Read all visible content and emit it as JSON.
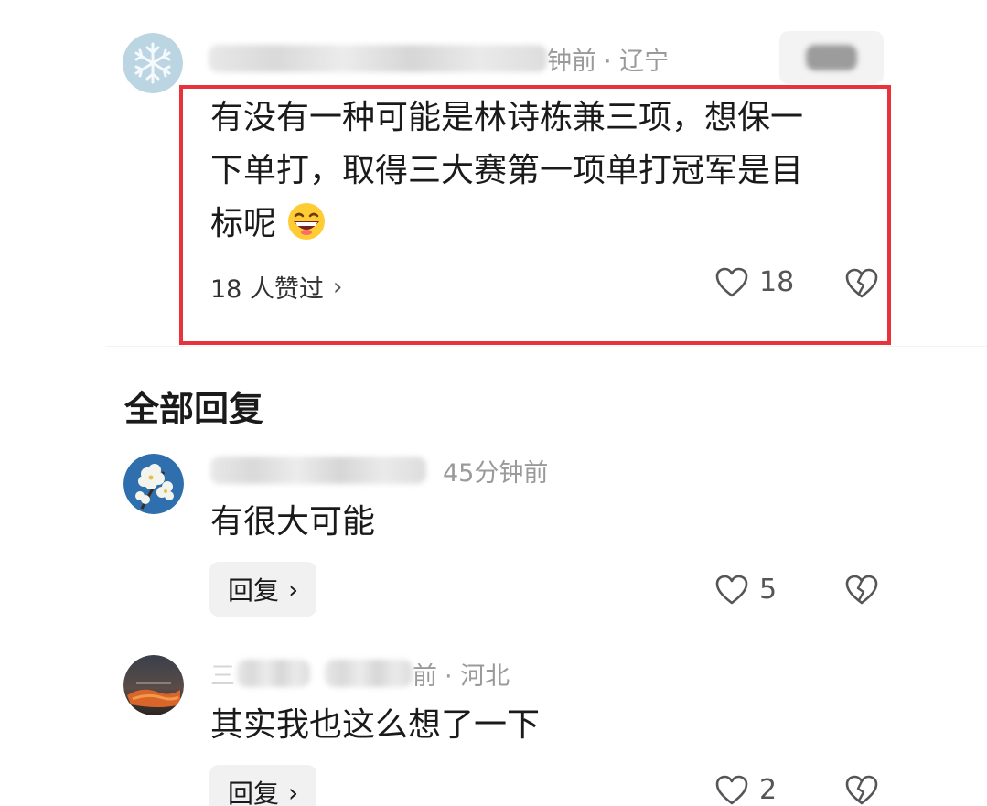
{
  "main_comment": {
    "meta_time": "钟前",
    "meta_location": "· 辽宁",
    "text_lines": [
      "有没有一种可能是林诗栋兼三项，想保一",
      "下单打，取得三大赛第一项单打冠军是目",
      "标呢"
    ],
    "emoji": "grinning-face-emoji",
    "likers": "18 人赞过",
    "likers_chevron": "›",
    "like_count": "18"
  },
  "section": {
    "title": "全部回复"
  },
  "replies": [
    {
      "meta_time": "45分钟前",
      "text": "有很大可能",
      "reply_label": "回复",
      "reply_chevron": "›",
      "like_count": "5"
    },
    {
      "meta_partial": "三",
      "meta_time": "前",
      "meta_location": "· 河北",
      "text": "其实我也这么想了一下",
      "reply_label": "回复",
      "reply_chevron": "›",
      "like_count": "2"
    }
  ],
  "colors": {
    "highlight": "#e8323c",
    "muted": "#9a9a9a",
    "reply_bg": "#f1f1f1"
  },
  "icons": [
    "heart-icon",
    "broken-heart-icon",
    "snowflake-avatar",
    "flower-avatar",
    "sunset-avatar"
  ]
}
